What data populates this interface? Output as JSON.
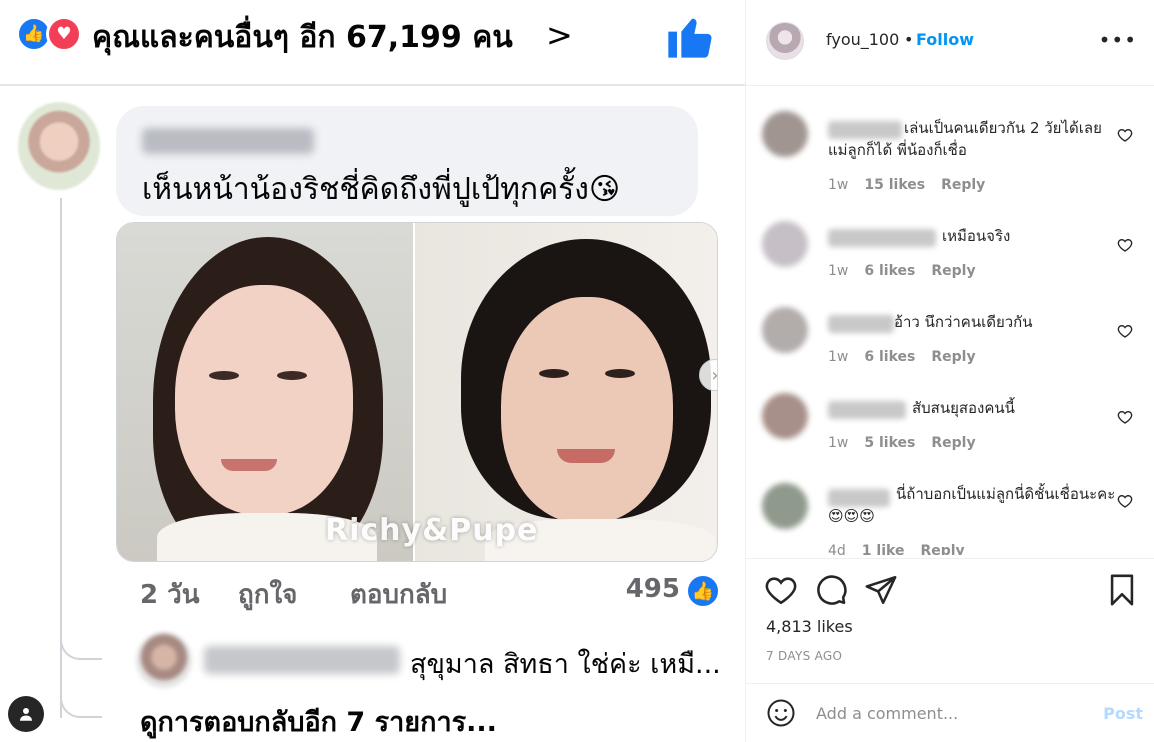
{
  "colors": {
    "accent": "#0095f6",
    "fb_like": "#1877f2",
    "fb_love": "#f33e58"
  },
  "fb_post": {
    "reactions_text": "คุณและคนอื่นๆ อีก 67,199 คน",
    "reaction_icons": [
      "like-icon",
      "love-icon"
    ],
    "comment": {
      "text": "เห็นหน้าน้องริชชี่คิดถึงพี่ปูเป้ทุกครั้ง😘"
    },
    "photo_watermark": "Richy&Pupe",
    "meta": {
      "time": "2 วัน",
      "like": "ถูกใจ",
      "reply": "ตอบกลับ",
      "like_count": "495"
    },
    "reply": {
      "text": "สุขุมาล สิทธา ใช่ค่ะ เหมื..."
    },
    "more_replies": "ดูการตอบกลับอีก 7 รายการ..."
  },
  "sidebar": {
    "owner": {
      "username": "fyou_100",
      "separator": "•",
      "follow_label": "Follow"
    },
    "comments": [
      {
        "text": "เล่นเป็นคนเดียวกัน 2 วัยได้เลย แม่ลูกก็ได้ พี่น้องก็เชื่อ",
        "time": "1w",
        "likes": "15 likes",
        "reply": "Reply"
      },
      {
        "text": "เหมือนจริง",
        "time": "1w",
        "likes": "6 likes",
        "reply": "Reply"
      },
      {
        "text": "อ้าว นึกว่าคนเดียวกัน",
        "time": "1w",
        "likes": "6 likes",
        "reply": "Reply"
      },
      {
        "text": "สับสนยุสองคนนี้",
        "time": "1w",
        "likes": "5 likes",
        "reply": "Reply"
      },
      {
        "text": "นี่ถ้าบอกเป็นแม่ลูกนี่ดิชั้นเชื่อนะคะ 😍😍😍",
        "time": "4d",
        "likes": "1 like",
        "reply": "Reply"
      }
    ],
    "likes_count": "4,813 likes",
    "date": "7 DAYS AGO",
    "add_comment": {
      "placeholder": "Add a comment...",
      "post_label": "Post"
    }
  }
}
